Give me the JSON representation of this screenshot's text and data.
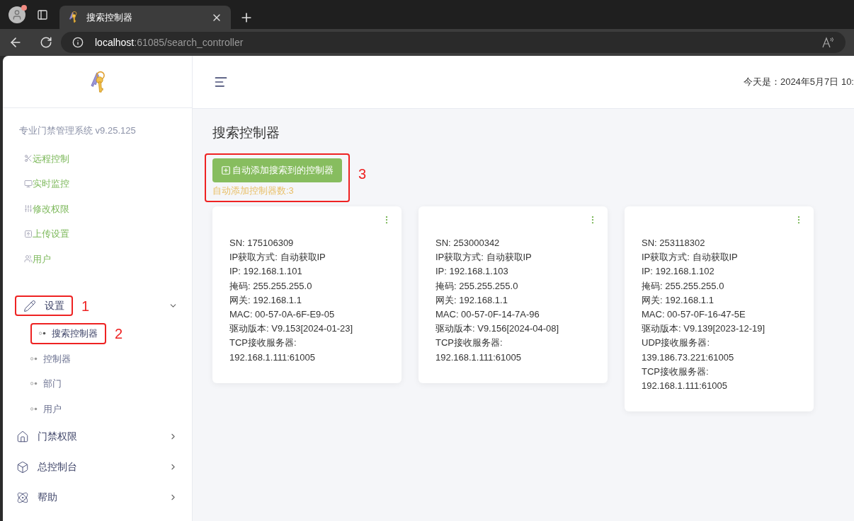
{
  "browser": {
    "tab_title": "搜索控制器",
    "url_host": "localhost",
    "url_path": ":61085/search_controller"
  },
  "header": {
    "date_text": "今天是：2024年5月7日 10:"
  },
  "sidebar": {
    "version": "专业门禁管理系统 v9.25.125",
    "quick_links": [
      {
        "label": "远程控制"
      },
      {
        "label": "实时监控"
      },
      {
        "label": "修改权限"
      },
      {
        "label": "上传设置"
      },
      {
        "label": "用户"
      }
    ],
    "menu": [
      {
        "label": "设置",
        "expanded": true,
        "annotation": "1",
        "children": [
          {
            "label": "搜索控制器",
            "selected": true,
            "annotation": "2"
          },
          {
            "label": "控制器",
            "selected": false
          },
          {
            "label": "部门",
            "selected": false
          },
          {
            "label": "用户",
            "selected": false
          }
        ]
      },
      {
        "label": "门禁权限",
        "expanded": false
      },
      {
        "label": "总控制台",
        "expanded": false
      },
      {
        "label": "帮助",
        "expanded": false
      }
    ]
  },
  "main": {
    "title": "搜索控制器",
    "auto_add_button": "自动添加搜索到的控制器",
    "count_text": "自动添加控制器数:3",
    "annotation": "3",
    "cards": [
      {
        "lines": [
          "SN: 175106309",
          "IP获取方式: 自动获取IP",
          "IP: 192.168.1.101",
          "掩码: 255.255.255.0",
          "网关: 192.168.1.1",
          "MAC: 00-57-0A-6F-E9-05",
          "驱动版本: V9.153[2024-01-23]",
          "TCP接收服务器:",
          "192.168.1.111:61005"
        ]
      },
      {
        "lines": [
          "SN: 253000342",
          "IP获取方式: 自动获取IP",
          "IP: 192.168.1.103",
          "掩码: 255.255.255.0",
          "网关: 192.168.1.1",
          "MAC: 00-57-0F-14-7A-96",
          "驱动版本: V9.156[2024-04-08]",
          "TCP接收服务器:",
          "192.168.1.111:61005"
        ]
      },
      {
        "lines": [
          "SN: 253118302",
          "IP获取方式: 自动获取IP",
          "IP: 192.168.1.102",
          "掩码: 255.255.255.0",
          "网关: 192.168.1.1",
          "MAC: 00-57-0F-16-47-5E",
          "驱动版本: V9.139[2023-12-19]",
          "UDP接收服务器:",
          "139.186.73.221:61005",
          "TCP接收服务器:",
          "192.168.1.111:61005"
        ]
      }
    ]
  }
}
